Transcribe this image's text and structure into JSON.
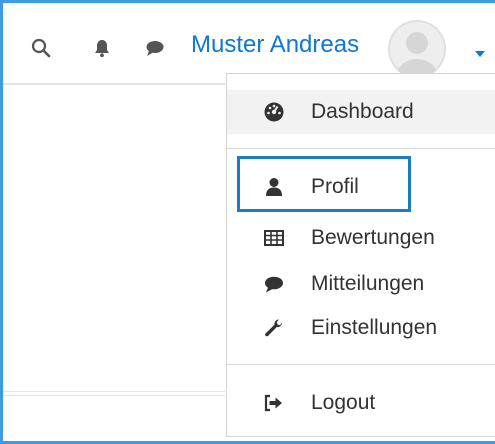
{
  "navbar": {
    "user_name": "Muster Andreas",
    "icons": [
      "search-icon",
      "bell-icon",
      "chat-icon",
      "avatar",
      "caret-down-icon"
    ]
  },
  "menu": {
    "items": [
      {
        "label": "Dashboard",
        "icon": "dashboard-icon"
      },
      {
        "label": "Profil",
        "icon": "user-icon"
      },
      {
        "label": "Bewertungen",
        "icon": "table-icon"
      },
      {
        "label": "Mitteilungen",
        "icon": "chat-icon"
      },
      {
        "label": "Einstellungen",
        "icon": "wrench-icon"
      },
      {
        "label": "Logout",
        "icon": "logout-icon"
      }
    ]
  },
  "colors": {
    "accent": "#1177d1",
    "frame": "#3d9be9",
    "highlight": "#1d7bc2",
    "text": "#333333"
  }
}
